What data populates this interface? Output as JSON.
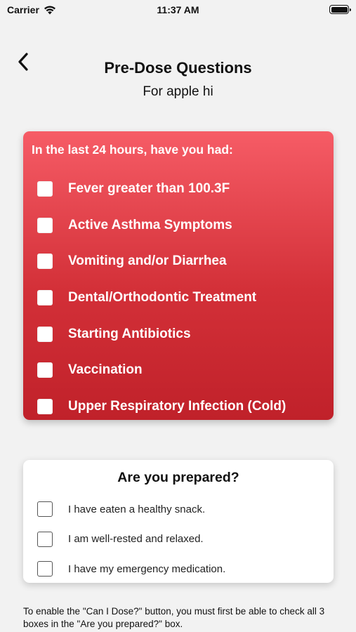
{
  "status_bar": {
    "carrier": "Carrier",
    "time": "11:37 AM"
  },
  "header": {
    "title": "Pre-Dose Questions",
    "subtitle": "For apple hi"
  },
  "symptoms": {
    "heading": "In the last 24 hours, have you had:",
    "items": [
      {
        "label": "Fever greater than 100.3F",
        "checked": false
      },
      {
        "label": "Active Asthma Symptoms",
        "checked": false
      },
      {
        "label": "Vomiting and/or Diarrhea",
        "checked": false
      },
      {
        "label": "Dental/Orthodontic Treatment",
        "checked": false
      },
      {
        "label": "Starting Antibiotics",
        "checked": false
      },
      {
        "label": "Vaccination",
        "checked": false
      },
      {
        "label": "Upper Respiratory Infection (Cold)",
        "checked": false
      }
    ]
  },
  "prepared": {
    "heading": "Are you prepared?",
    "items": [
      {
        "label": "I have eaten a healthy snack.",
        "checked": false
      },
      {
        "label": "I am well-rested and relaxed.",
        "checked": false
      },
      {
        "label": "I have my emergency medication.",
        "checked": false
      }
    ]
  },
  "footer": {
    "note": "To enable the \"Can I Dose?\" button, you must first be able to check all 3 boxes in the \"Are you prepared?\" box."
  },
  "colors": {
    "symptom_card_top": "#f65c66",
    "symptom_card_bottom": "#c0212a",
    "background": "#f2f2f2"
  }
}
